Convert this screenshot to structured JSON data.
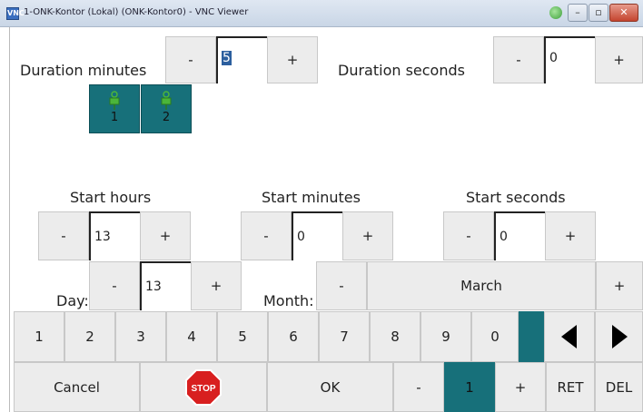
{
  "window": {
    "title": "1-ONK-Kontor (Lokal) (ONK-Kontor0) - VNC Viewer",
    "app_icon": "VNC",
    "controls": [
      "–",
      "▫",
      "✕"
    ]
  },
  "duration": {
    "minutes_label": "Duration minutes",
    "minutes_value": "5",
    "seconds_label": "Duration seconds",
    "seconds_value": "0"
  },
  "channels": [
    {
      "number": "1",
      "icon": "plug-icon"
    },
    {
      "number": "2",
      "icon": "plug-icon"
    }
  ],
  "start": {
    "hours_label": "Start hours",
    "hours_value": "13",
    "minutes_label": "Start minutes",
    "minutes_value": "0",
    "seconds_label": "Start seconds",
    "seconds_value": "0"
  },
  "date": {
    "day_label": "Day:",
    "day_value": "13",
    "month_label": "Month:",
    "month_value": "March"
  },
  "buttons": {
    "minus": "-",
    "plus": "+"
  },
  "keypad": {
    "digits": [
      "1",
      "2",
      "3",
      "4",
      "5",
      "6",
      "7",
      "8",
      "9",
      "0"
    ],
    "left_icon": "triangle-left-icon",
    "right_icon": "triangle-right-icon"
  },
  "bottom": {
    "cancel": "Cancel",
    "stop": "STOP",
    "ok": "OK",
    "minus": "-",
    "page_value": "1",
    "plus": "+",
    "ret": "RET",
    "del": "DEL"
  },
  "colors": {
    "teal": "#17707a",
    "stop_red": "#d81f1f"
  }
}
